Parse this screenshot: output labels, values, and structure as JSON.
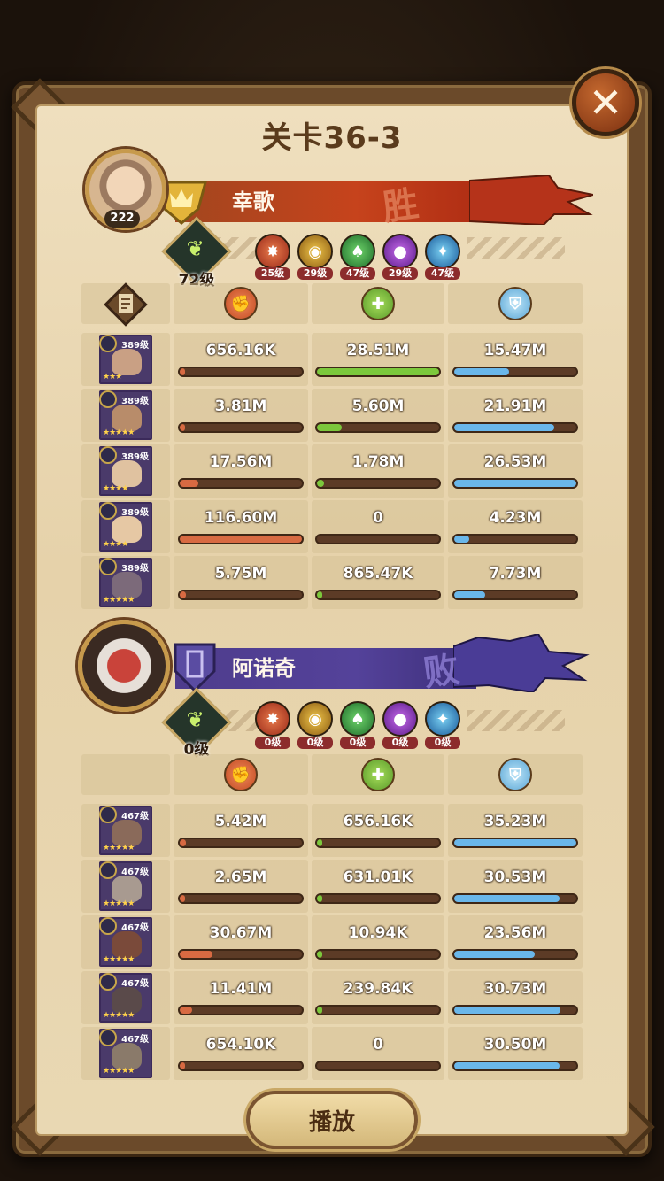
{
  "title": "关卡36-3",
  "close_icon": "close-icon",
  "play_label": "播放",
  "colors": {
    "damage": "#d86a42",
    "heal": "#7cc83c",
    "tank": "#6ab7ea",
    "win_banner": "#b5431d",
    "lose_banner": "#4d3d92"
  },
  "teams": [
    {
      "name": "幸歌",
      "player_level": "222",
      "result": "胜",
      "tree_level": "72级",
      "factions": [
        {
          "icon": "lightbearer-icon",
          "level": "25级"
        },
        {
          "icon": "mauler-icon",
          "level": "29级"
        },
        {
          "icon": "wilder-icon",
          "level": "47级"
        },
        {
          "icon": "graveborn-icon",
          "level": "29级"
        },
        {
          "icon": "celestial-icon",
          "level": "47级"
        }
      ],
      "headers": [
        "damage-icon",
        "heal-icon",
        "shield-icon"
      ],
      "heroes": [
        {
          "hero_level": "389级",
          "stars": "★★★",
          "damage": "656.16K",
          "damage_pct": 0.04,
          "heal": "28.51M",
          "heal_pct": 1.0,
          "tank": "15.47M",
          "tank_pct": 0.45
        },
        {
          "hero_level": "389级",
          "stars": "★★★★★",
          "damage": "3.81M",
          "damage_pct": 0.04,
          "heal": "5.60M",
          "heal_pct": 0.2,
          "tank": "21.91M",
          "tank_pct": 0.82
        },
        {
          "hero_level": "389级",
          "stars": "★★★★",
          "damage": "17.56M",
          "damage_pct": 0.15,
          "heal": "1.78M",
          "heal_pct": 0.06,
          "tank": "26.53M",
          "tank_pct": 1.0
        },
        {
          "hero_level": "389级",
          "stars": "★★★★",
          "damage": "116.60M",
          "damage_pct": 1.0,
          "heal": "0",
          "heal_pct": 0,
          "tank": "4.23M",
          "tank_pct": 0.12
        },
        {
          "hero_level": "389级",
          "stars": "★★★★★",
          "damage": "5.75M",
          "damage_pct": 0.05,
          "heal": "865.47K",
          "heal_pct": 0.03,
          "tank": "7.73M",
          "tank_pct": 0.25
        }
      ]
    },
    {
      "name": "阿诺奇",
      "result": "败",
      "tree_level": "0级",
      "factions": [
        {
          "icon": "lightbearer-icon",
          "level": "0级"
        },
        {
          "icon": "mauler-icon",
          "level": "0级"
        },
        {
          "icon": "wilder-icon",
          "level": "0级"
        },
        {
          "icon": "graveborn-icon",
          "level": "0级"
        },
        {
          "icon": "celestial-icon",
          "level": "0级"
        }
      ],
      "headers": [
        "damage-icon",
        "heal-icon",
        "shield-icon"
      ],
      "heroes": [
        {
          "hero_level": "467级",
          "stars": "★★★★★",
          "damage": "5.42M",
          "damage_pct": 0.05,
          "heal": "656.16K",
          "heal_pct": 0.04,
          "tank": "35.23M",
          "tank_pct": 1.0
        },
        {
          "hero_level": "467级",
          "stars": "★★★★★",
          "damage": "2.65M",
          "damage_pct": 0.03,
          "heal": "631.01K",
          "heal_pct": 0.04,
          "tank": "30.53M",
          "tank_pct": 0.86
        },
        {
          "hero_level": "467级",
          "stars": "★★★★★",
          "damage": "30.67M",
          "damage_pct": 0.27,
          "heal": "10.94K",
          "heal_pct": 0.01,
          "tank": "23.56M",
          "tank_pct": 0.66
        },
        {
          "hero_level": "467级",
          "stars": "★★★★★",
          "damage": "11.41M",
          "damage_pct": 0.1,
          "heal": "239.84K",
          "heal_pct": 0.02,
          "tank": "30.73M",
          "tank_pct": 0.87
        },
        {
          "hero_level": "467级",
          "stars": "★★★★★",
          "damage": "654.10K",
          "damage_pct": 0.02,
          "heal": "0",
          "heal_pct": 0,
          "tank": "30.50M",
          "tank_pct": 0.86
        }
      ]
    }
  ]
}
